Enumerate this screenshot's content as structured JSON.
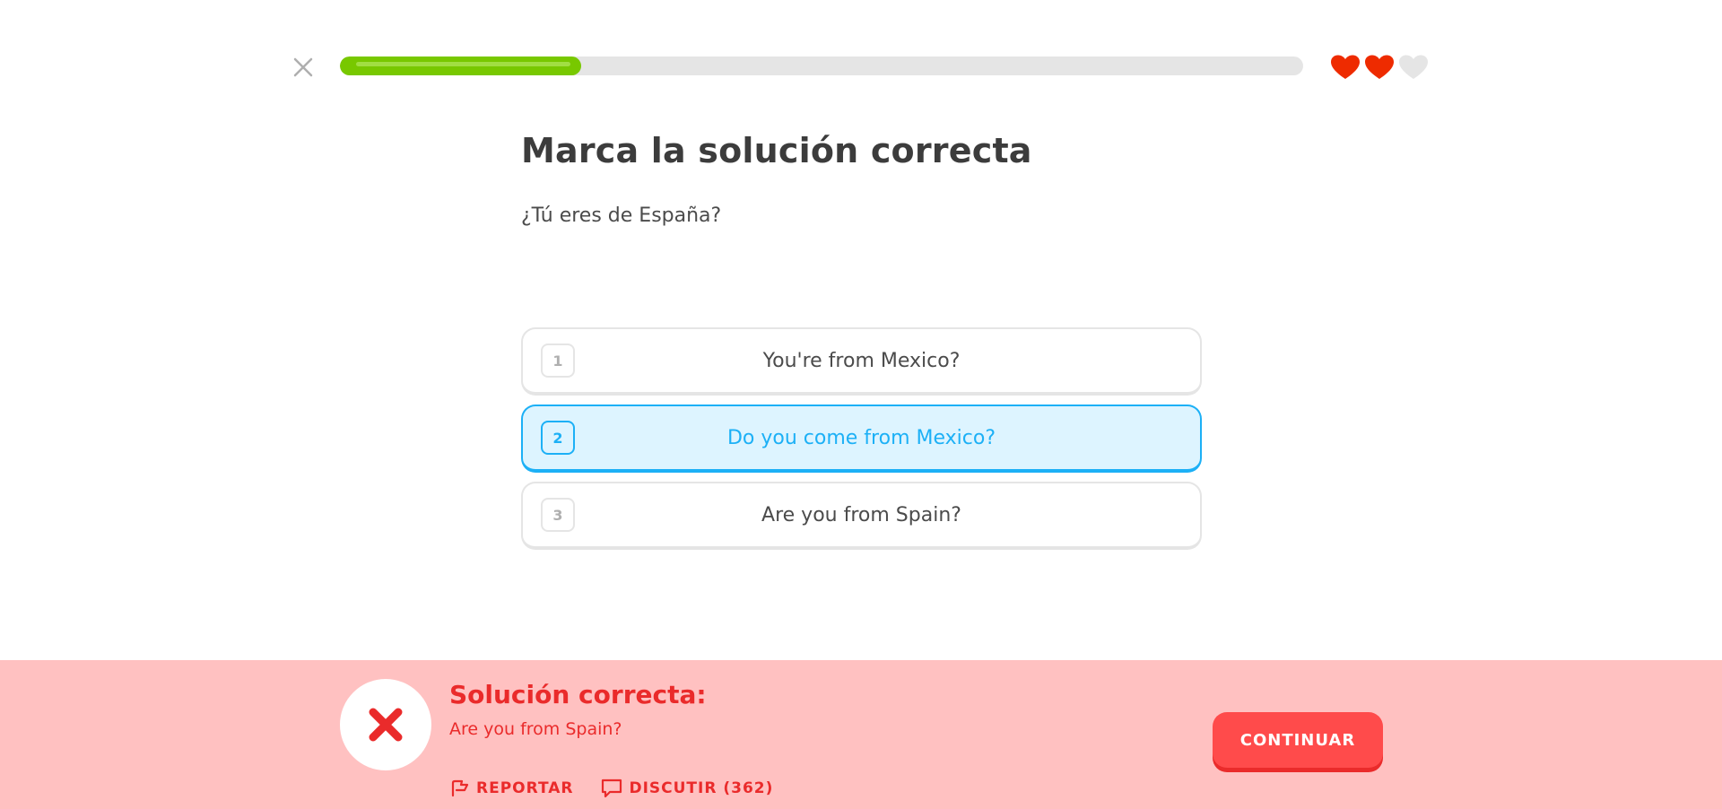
{
  "header": {
    "progress_percent": 25,
    "lives_total": 3,
    "lives_remaining": 2,
    "colors": {
      "progress": "#78c800",
      "heart_full": "#ee2b00",
      "heart_empty": "#e5e5e5"
    }
  },
  "challenge": {
    "title": "Marca la solución correcta",
    "prompt": "¿Tú eres de España?",
    "options": [
      {
        "number": "1",
        "label": "You're from Mexico?",
        "selected": false
      },
      {
        "number": "2",
        "label": "Do you come from Mexico?",
        "selected": true
      },
      {
        "number": "3",
        "label": "Are you from Spain?",
        "selected": false
      }
    ]
  },
  "feedback": {
    "title": "Solución correcta:",
    "answer": "Are you from Spain?",
    "report_label": "REPORTAR",
    "discuss_label": "DISCUTIR (362)",
    "continue_label": "CONTINUAR",
    "colors": {
      "background": "#ffc1c1",
      "accent": "#ea2b2b",
      "button": "#ff4b4b"
    }
  }
}
